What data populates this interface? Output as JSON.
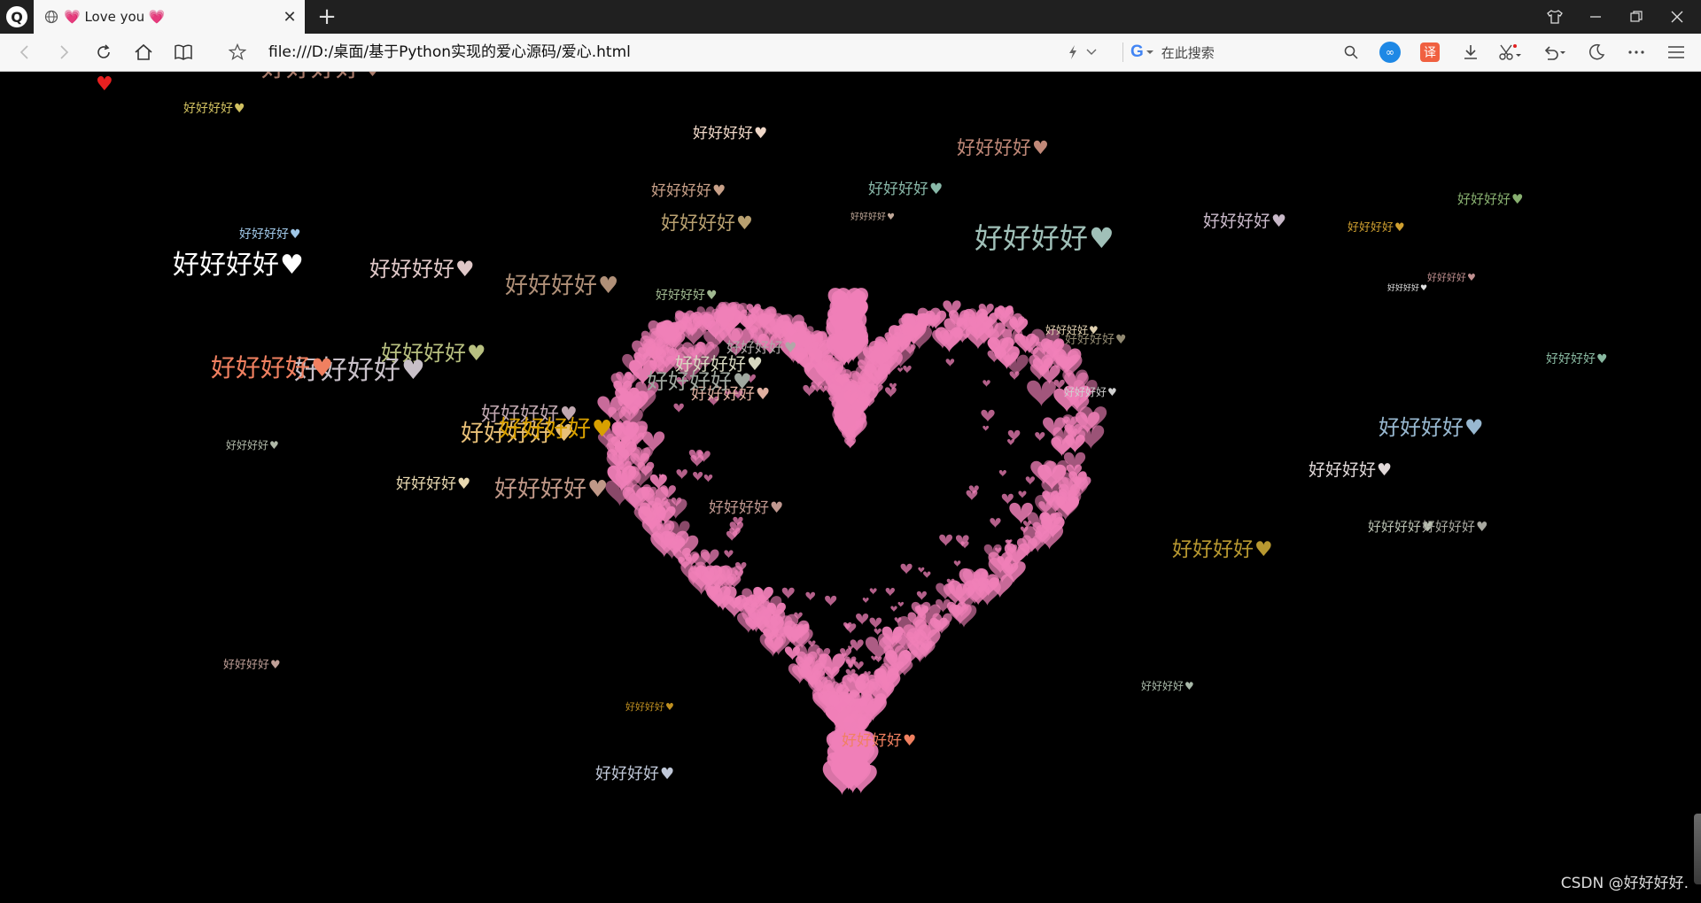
{
  "browser": {
    "tab_title": "💗 Love you 💗",
    "url": "file:///D:/桌面/基于Python实现的爱心源码/爱心.html",
    "search_placeholder": "在此搜索",
    "icons": [
      "back-icon",
      "forward-icon",
      "reload-icon",
      "home-icon",
      "reader-icon",
      "bookmark-star-icon",
      "lightning-icon",
      "google-icon",
      "search-icon",
      "extension-icon",
      "translate-icon",
      "download-icon",
      "scissors-icon",
      "undo-icon",
      "dark-mode-icon",
      "more-icon",
      "menu-icon"
    ]
  },
  "page": {
    "background": "#000000",
    "heart_color": "#f080b8",
    "watermark": "CSDN @好好好好.",
    "floating_text": "好好好好",
    "floating_heart": "♥",
    "floats": [
      {
        "text": "好好好好",
        "color": "#a87a6a"
      },
      {
        "text": "好好好好",
        "color": "#b8c080"
      },
      {
        "text": "好好好好",
        "color": "#e0b0a0"
      },
      {
        "text": "好好好好",
        "color": "#f0d8c8"
      },
      {
        "text": "好好好好",
        "color": "#c8a088"
      },
      {
        "text": "好好好好",
        "color": "#88b8a8"
      },
      {
        "text": "好好好好",
        "color": "#b8a070"
      },
      {
        "text": "好好好好",
        "color": "#c08878"
      },
      {
        "text": "好好好好",
        "color": "#c0a898"
      },
      {
        "text": "好好好好",
        "color": "#a0c0b8"
      },
      {
        "text": "好好好好",
        "color": "#c8b8c8"
      },
      {
        "text": "好好好好",
        "color": "#88b070"
      },
      {
        "text": "好好好好",
        "color": "#d0a030"
      },
      {
        "text": "好好好好",
        "color": "#ffffff"
      },
      {
        "text": "好好好好",
        "color": "#e0c8c8"
      },
      {
        "text": "好好好好",
        "color": "#a0c8e8"
      },
      {
        "text": "好好好好",
        "color": "#b09078"
      },
      {
        "text": "好好好好",
        "color": "#c8c0c8"
      },
      {
        "text": "好好好好",
        "color": "#f08060"
      },
      {
        "text": "好好好好",
        "color": "#a0a8a0"
      },
      {
        "text": "好好好好",
        "color": "#d8d8c0"
      },
      {
        "text": "好好好好",
        "color": "#c0a8b0"
      },
      {
        "text": "好好好好",
        "color": "#e8c078"
      },
      {
        "text": "好好好好",
        "color": "#d8a000"
      },
      {
        "text": "好好好好",
        "color": "#e8d8b0"
      },
      {
        "text": "好好好好",
        "color": "#c09888"
      },
      {
        "text": "好好好好",
        "color": "#b0b8a8"
      },
      {
        "text": "好好好好",
        "color": "#c09890"
      },
      {
        "text": "好好好好",
        "color": "#98b8d0"
      },
      {
        "text": "好好好好",
        "color": "#e0d8d8"
      },
      {
        "text": "好好好好",
        "color": "#b89830"
      },
      {
        "text": "好好好好",
        "color": "#b8c0b0"
      },
      {
        "text": "好好好好",
        "color": "#a8a8a0"
      },
      {
        "text": "好好好好",
        "color": "#88b8a0"
      },
      {
        "text": "好好好好",
        "color": "#f08060"
      },
      {
        "text": "好好好好",
        "color": "#c0c8d8"
      },
      {
        "text": "好好好好",
        "color": "#c0a098"
      },
      {
        "text": "好好好好",
        "color": "#c09020"
      },
      {
        "text": "好好好好",
        "color": "#a8b8a8"
      },
      {
        "text": "好好好好",
        "color": "#b0a8a8"
      },
      {
        "text": "好好好好",
        "color": "#a0b890"
      },
      {
        "text": "好好好好",
        "color": "#908870"
      },
      {
        "text": "好好好好",
        "color": "#e0d0b0"
      },
      {
        "text": "好好好好",
        "color": "#d0d0d0"
      },
      {
        "text": "好好好好",
        "color": "#c09090"
      },
      {
        "text": "好好好好",
        "color": "#e0e0e0"
      },
      {
        "text": "好好好好",
        "color": "#d0c060"
      }
    ]
  }
}
